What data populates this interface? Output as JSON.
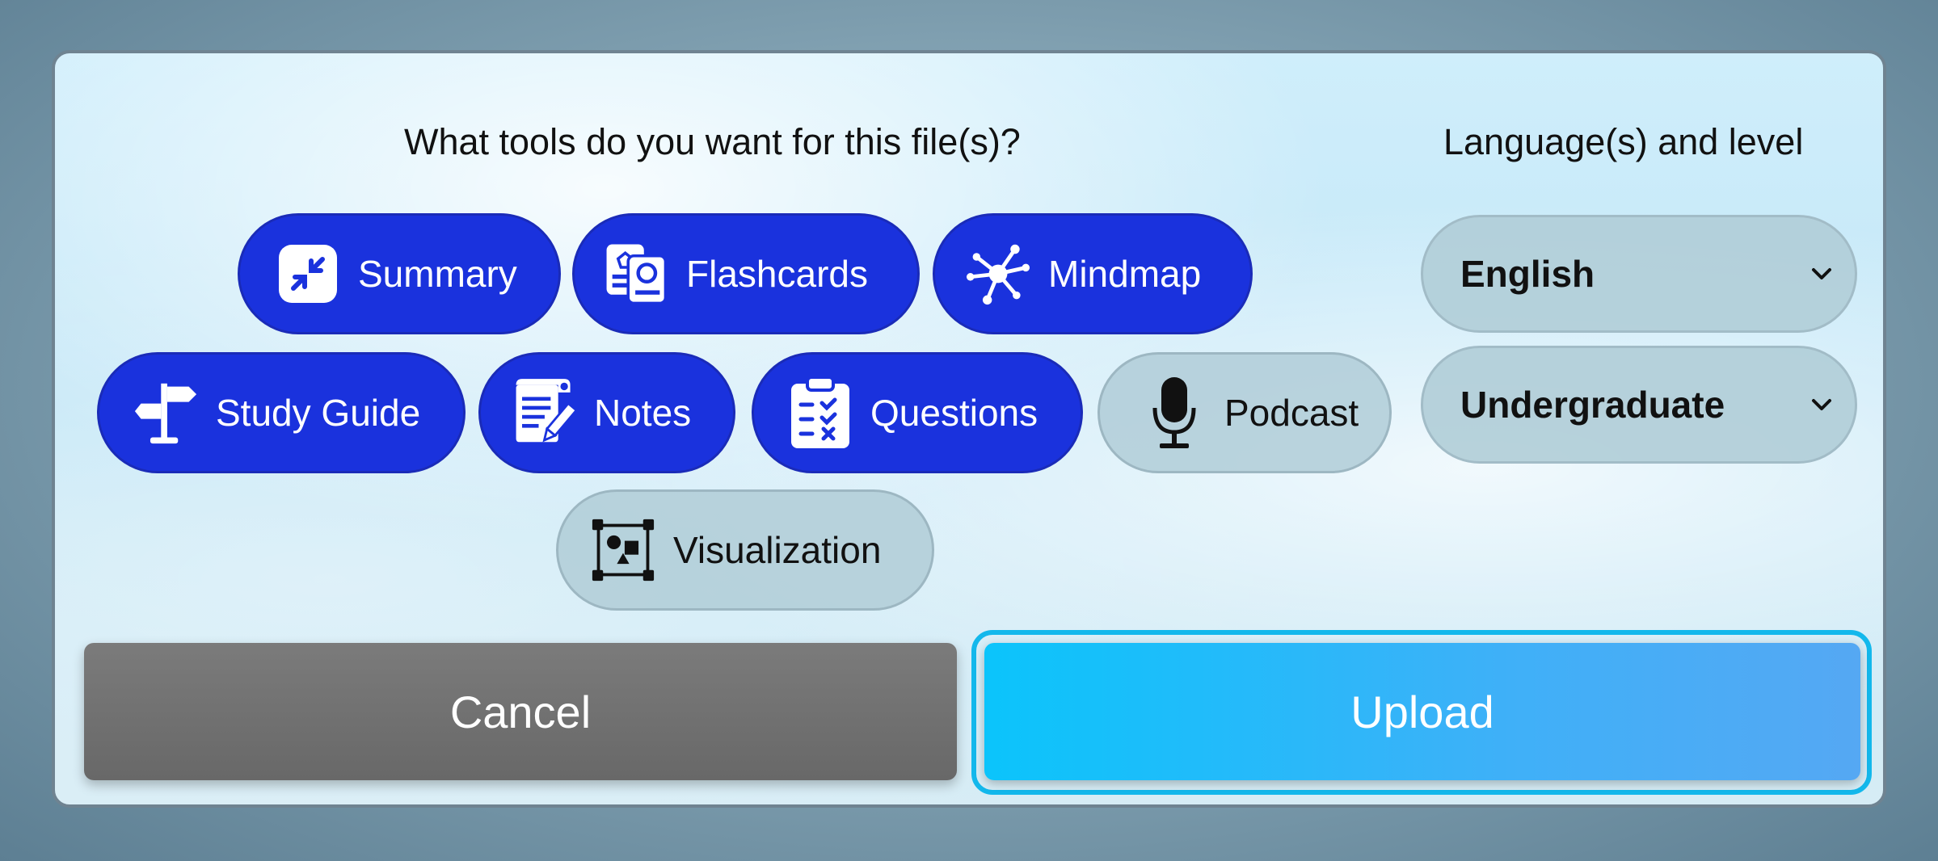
{
  "dialog": {
    "tools_heading": "What tools do you want for this file(s)?",
    "language_heading": "Language(s) and level"
  },
  "tools": [
    {
      "label": "Summary",
      "icon": "compress-icon",
      "selected": true
    },
    {
      "label": "Flashcards",
      "icon": "flashcards-icon",
      "selected": true
    },
    {
      "label": "Mindmap",
      "icon": "mindmap-icon",
      "selected": true
    },
    {
      "label": "Study Guide",
      "icon": "signpost-icon",
      "selected": true
    },
    {
      "label": "Notes",
      "icon": "notes-icon",
      "selected": true
    },
    {
      "label": "Questions",
      "icon": "clipboard-checklist-icon",
      "selected": true
    },
    {
      "label": "Podcast",
      "icon": "microphone-icon",
      "selected": false
    },
    {
      "label": "Visualization",
      "icon": "shapes-icon",
      "selected": false
    }
  ],
  "language_select": {
    "value": "English",
    "icon": "chevron-down-icon"
  },
  "level_select": {
    "value": "Undergraduate",
    "icon": "chevron-down-icon"
  },
  "actions": {
    "cancel_label": "Cancel",
    "upload_label": "Upload"
  },
  "colors": {
    "selected_chip": "#1a32dd",
    "unselected_chip": "#b0cdd7",
    "upload_button": "#0bc4fb",
    "cancel_button": "#707070"
  }
}
